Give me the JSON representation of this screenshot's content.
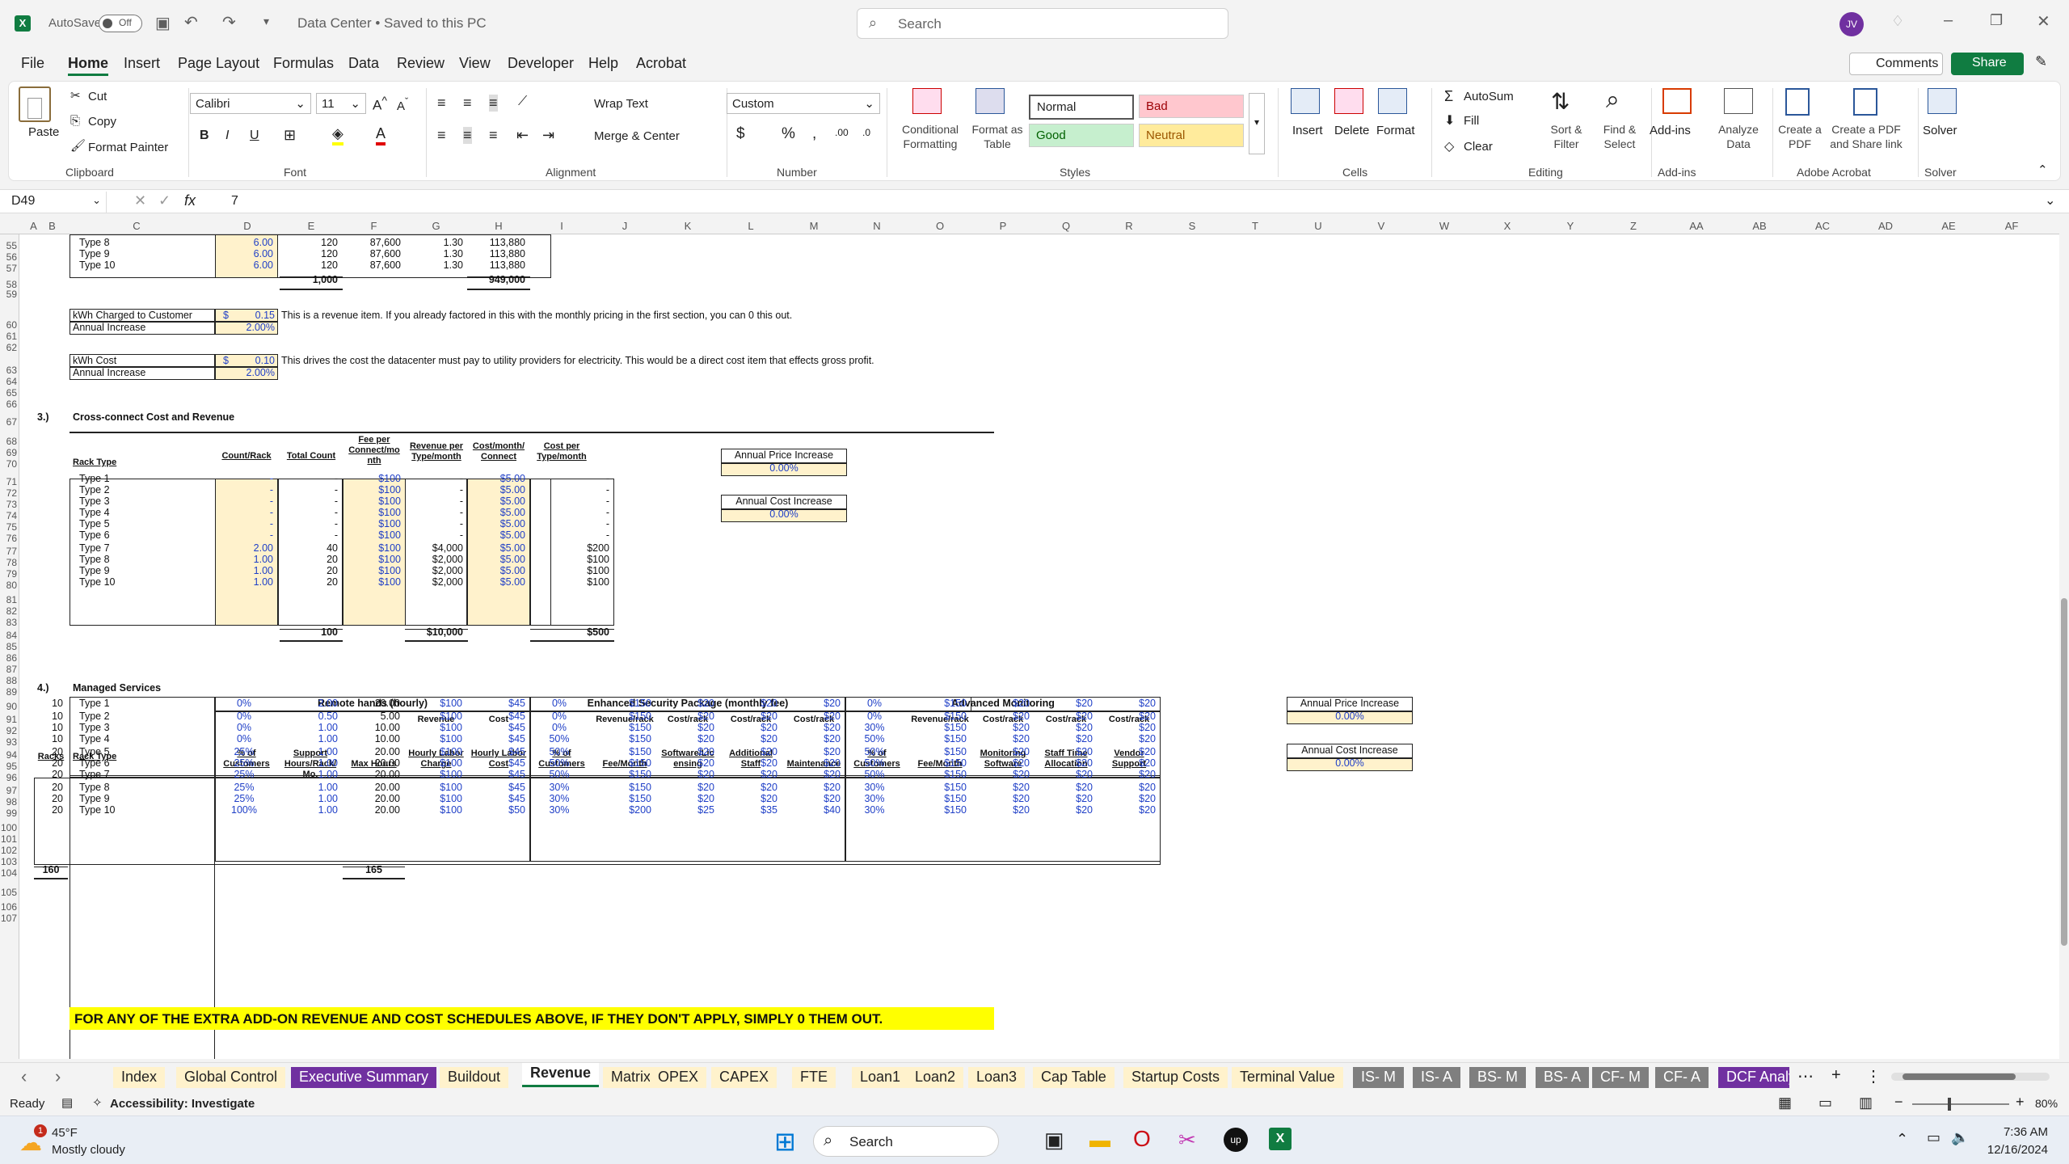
{
  "titlebar": {
    "app_icon": "excel-icon",
    "autosave_label": "AutoSave",
    "autosave_state": "Off",
    "doc_title": "Data Center  •  Saved to this PC",
    "search_placeholder": "Search",
    "avatar_initials": "JV"
  },
  "menu": [
    "File",
    "Home",
    "Insert",
    "Page Layout",
    "Formulas",
    "Data",
    "Review",
    "View",
    "Developer",
    "Help",
    "Acrobat"
  ],
  "menu_active": "Home",
  "menu_right": {
    "comments": "Comments",
    "share": "Share"
  },
  "ribbon": {
    "clipboard": {
      "paste": "Paste",
      "cut": "Cut",
      "copy": "Copy",
      "format_painter": "Format Painter",
      "group": "Clipboard"
    },
    "font": {
      "name": "Calibri",
      "size": "11",
      "group": "Font"
    },
    "alignment": {
      "wrap": "Wrap Text",
      "merge": "Merge & Center",
      "group": "Alignment"
    },
    "number": {
      "format": "Custom",
      "group": "Number"
    },
    "styles": {
      "cond": "Conditional Formatting",
      "format_table": "Format as Table",
      "normal": "Normal",
      "bad": "Bad",
      "good": "Good",
      "neutral": "Neutral",
      "group": "Styles"
    },
    "cells": {
      "insert": "Insert",
      "delete": "Delete",
      "format": "Format",
      "group": "Cells"
    },
    "editing": {
      "autosum": "AutoSum",
      "fill": "Fill",
      "clear": "Clear",
      "sort": "Sort & Filter",
      "find": "Find & Select",
      "group": "Editing"
    },
    "addins": {
      "label": "Add-ins",
      "analyze": "Analyze Data",
      "group": "Add-ins"
    },
    "acrobat": {
      "create_pdf": "Create a PDF",
      "create_share": "Create a PDF and Share link",
      "group": "Adobe Acrobat"
    },
    "solver": {
      "label": "Solver",
      "group": "Solver"
    }
  },
  "formula_bar": {
    "name_box": "D49",
    "formula": "7"
  },
  "columns": [
    "A",
    "B",
    "C",
    "D",
    "E",
    "F",
    "G",
    "H",
    "I",
    "J",
    "K",
    "L",
    "M",
    "N",
    "O",
    "P",
    "Q",
    "R",
    "S",
    "T",
    "U",
    "V",
    "W",
    "X",
    "Y",
    "Z",
    "AA",
    "AB",
    "AC",
    "AD",
    "AE",
    "AF"
  ],
  "rows": [
    "55",
    "56",
    "57",
    "58",
    "59",
    "60",
    "61",
    "62",
    "63",
    "64",
    "65",
    "66",
    "67",
    "68",
    "69",
    "70",
    "71",
    "72",
    "73",
    "74",
    "75",
    "76",
    "77",
    "78",
    "79",
    "80",
    "81",
    "82",
    "83",
    "84",
    "85",
    "86",
    "87",
    "88",
    "89",
    "90",
    "91",
    "92",
    "93",
    "94",
    "95",
    "96",
    "97",
    "98",
    "99",
    "100",
    "101",
    "102",
    "103",
    "104",
    "105",
    "106",
    "107"
  ],
  "sec2": {
    "rows": [
      [
        "Type 8",
        "6.00",
        "120",
        "87,600",
        "1.30",
        "113,880"
      ],
      [
        "Type 9",
        "6.00",
        "120",
        "87,600",
        "1.30",
        "113,880"
      ],
      [
        "Type 10",
        "6.00",
        "120",
        "87,600",
        "1.30",
        "113,880"
      ]
    ],
    "total_e": "1,000",
    "total_h": "949,000",
    "kwh_charged": "kWh Charged to Customer",
    "kwh_charged_val": "0.15",
    "dollar": "$",
    "annual_increase": "Annual Increase",
    "ai1": "2.00%",
    "note1": "This is a revenue item. If you already factored in this with the monthly pricing in the first section, you can 0 this out.",
    "kwh_cost": "kWh Cost",
    "kwh_cost_val": "0.10",
    "ai2": "2.00%",
    "note2": "This drives the cost the datacenter must pay to utility providers for electricity. This would be a direct cost item that effects gross profit."
  },
  "sec3": {
    "num": "3.)",
    "title": "Cross-connect Cost and Revenue",
    "headers": [
      "Rack Type",
      "Count/Rack",
      "Total Count",
      "Fee per Connect/mo nth",
      "Revenue per Type/month",
      "Cost/month/ Connect",
      "Cost per Type/month"
    ],
    "rows": [
      [
        "Type 1",
        "-",
        "-",
        "$100",
        "-",
        "$5.00",
        "-"
      ],
      [
        "Type 2",
        "-",
        "-",
        "$100",
        "-",
        "$5.00",
        "-"
      ],
      [
        "Type 3",
        "-",
        "-",
        "$100",
        "-",
        "$5.00",
        "-"
      ],
      [
        "Type 4",
        "-",
        "-",
        "$100",
        "-",
        "$5.00",
        "-"
      ],
      [
        "Type 5",
        "-",
        "-",
        "$100",
        "-",
        "$5.00",
        "-"
      ],
      [
        "Type 6",
        "-",
        "-",
        "$100",
        "-",
        "$5.00",
        "-"
      ],
      [
        "Type 7",
        "2.00",
        "40",
        "$100",
        "$4,000",
        "$5.00",
        "$200"
      ],
      [
        "Type 8",
        "1.00",
        "20",
        "$100",
        "$2,000",
        "$5.00",
        "$100"
      ],
      [
        "Type 9",
        "1.00",
        "20",
        "$100",
        "$2,000",
        "$5.00",
        "$100"
      ],
      [
        "Type 10",
        "1.00",
        "20",
        "$100",
        "$2,000",
        "$5.00",
        "$100"
      ]
    ],
    "totals": [
      "100",
      "$10,000",
      "$500"
    ],
    "price_inc_label": "Annual Price Increase",
    "price_inc": "0.00%",
    "cost_inc_label": "Annual Cost Increase",
    "cost_inc": "0.00%"
  },
  "sec4": {
    "num": "4.)",
    "title": "Managed Services",
    "group1": "Remote hands (hourly)",
    "group2": "Enhanced Security Package (monthly fee)",
    "group3": "Advanced Monitoring",
    "hdr_top": [
      "",
      "",
      "",
      "",
      "",
      "Revenue",
      "Cost",
      "",
      "Revenue/rack",
      "Cost/rack",
      "Cost/rack",
      "Cost/rack",
      "",
      "Revenue/rack",
      "Cost/rack",
      "Cost/rack",
      "Cost/rack"
    ],
    "hdr_bot": [
      "Racks",
      "Rack Type",
      "% of Customers",
      "Support Hours/Rack/ Mo.",
      "Max Hours",
      "Hourly Labor Charge",
      "Hourly Labor Cost",
      "% of Customers",
      "Fee/Month",
      "Software/Lic ensing",
      "Additional Staff",
      "Maintenance",
      "% of Customers",
      "Fee/Month",
      "Monitoring Software",
      "Staff Time Allocation",
      "Vendor Support"
    ],
    "rows": [
      [
        "10",
        "Type 1",
        "0%",
        "2.00",
        "20.00",
        "$100",
        "$45",
        "0%",
        "$150",
        "$20",
        "$20",
        "$20",
        "0%",
        "$150",
        "$20",
        "$20",
        "$20"
      ],
      [
        "10",
        "Type 2",
        "0%",
        "0.50",
        "5.00",
        "$100",
        "$45",
        "0%",
        "$150",
        "$20",
        "$20",
        "$20",
        "0%",
        "$150",
        "$20",
        "$20",
        "$20"
      ],
      [
        "10",
        "Type 3",
        "0%",
        "1.00",
        "10.00",
        "$100",
        "$45",
        "0%",
        "$150",
        "$20",
        "$20",
        "$20",
        "30%",
        "$150",
        "$20",
        "$20",
        "$20"
      ],
      [
        "10",
        "Type 4",
        "0%",
        "1.00",
        "10.00",
        "$100",
        "$45",
        "50%",
        "$150",
        "$20",
        "$20",
        "$20",
        "50%",
        "$150",
        "$20",
        "$20",
        "$20"
      ],
      [
        "20",
        "Type 5",
        "25%",
        "1.00",
        "20.00",
        "$100",
        "$45",
        "50%",
        "$150",
        "$20",
        "$20",
        "$20",
        "50%",
        "$150",
        "$20",
        "$20",
        "$20"
      ],
      [
        "20",
        "Type 6",
        "25%",
        "1.00",
        "20.00",
        "$100",
        "$45",
        "50%",
        "$150",
        "$20",
        "$20",
        "$20",
        "50%",
        "$150",
        "$20",
        "$20",
        "$20"
      ],
      [
        "20",
        "Type 7",
        "25%",
        "1.00",
        "20.00",
        "$100",
        "$45",
        "50%",
        "$150",
        "$20",
        "$20",
        "$20",
        "50%",
        "$150",
        "$20",
        "$20",
        "$20"
      ],
      [
        "20",
        "Type 8",
        "25%",
        "1.00",
        "20.00",
        "$100",
        "$45",
        "30%",
        "$150",
        "$20",
        "$20",
        "$20",
        "30%",
        "$150",
        "$20",
        "$20",
        "$20"
      ],
      [
        "20",
        "Type 9",
        "25%",
        "1.00",
        "20.00",
        "$100",
        "$45",
        "30%",
        "$150",
        "$20",
        "$20",
        "$20",
        "30%",
        "$150",
        "$20",
        "$20",
        "$20"
      ],
      [
        "20",
        "Type 10",
        "100%",
        "1.00",
        "20.00",
        "$100",
        "$50",
        "30%",
        "$200",
        "$25",
        "$35",
        "$40",
        "30%",
        "$150",
        "$20",
        "$20",
        "$20"
      ]
    ],
    "total_racks": "160",
    "total_hours": "165",
    "price_inc_label": "Annual Price Increase",
    "price_inc": "0.00%",
    "cost_inc_label": "Annual Cost Increase",
    "cost_inc": "0.00%"
  },
  "banner": "FOR ANY OF THE EXTRA ADD-ON REVENUE AND COST SCHEDULES ABOVE, IF THEY DON'T APPLY, SIMPLY 0 THEM OUT.",
  "tabs": [
    "Index",
    "Global Control",
    "Executive Summary",
    "Buildout",
    "Revenue",
    "Matrix",
    "OPEX",
    "CAPEX",
    "FTE",
    "Loan1",
    "Loan2",
    "Loan3",
    "Cap Table",
    "Startup Costs",
    "Terminal Value",
    "IS- M",
    "IS- A",
    "BS- M",
    "BS- A",
    "CF- M",
    "CF- A",
    "DCF Analy"
  ],
  "active_tab": "Revenue",
  "status": {
    "ready": "Ready",
    "accessibility": "Accessibility: Investigate",
    "zoom": "80%"
  },
  "taskbar": {
    "temp": "45°F",
    "weather": "Mostly cloudy",
    "badge": "1",
    "search": "Search",
    "time": "7:36 AM",
    "date": "12/16/2024"
  },
  "colors": {
    "excel_green": "#107c41",
    "purple_tab": "#7030a0",
    "gray_tab": "#7f7f7f",
    "input_yellow": "#fff2cc",
    "input_blue": "#1f3fc7",
    "banner_yellow": "#ffff00"
  }
}
